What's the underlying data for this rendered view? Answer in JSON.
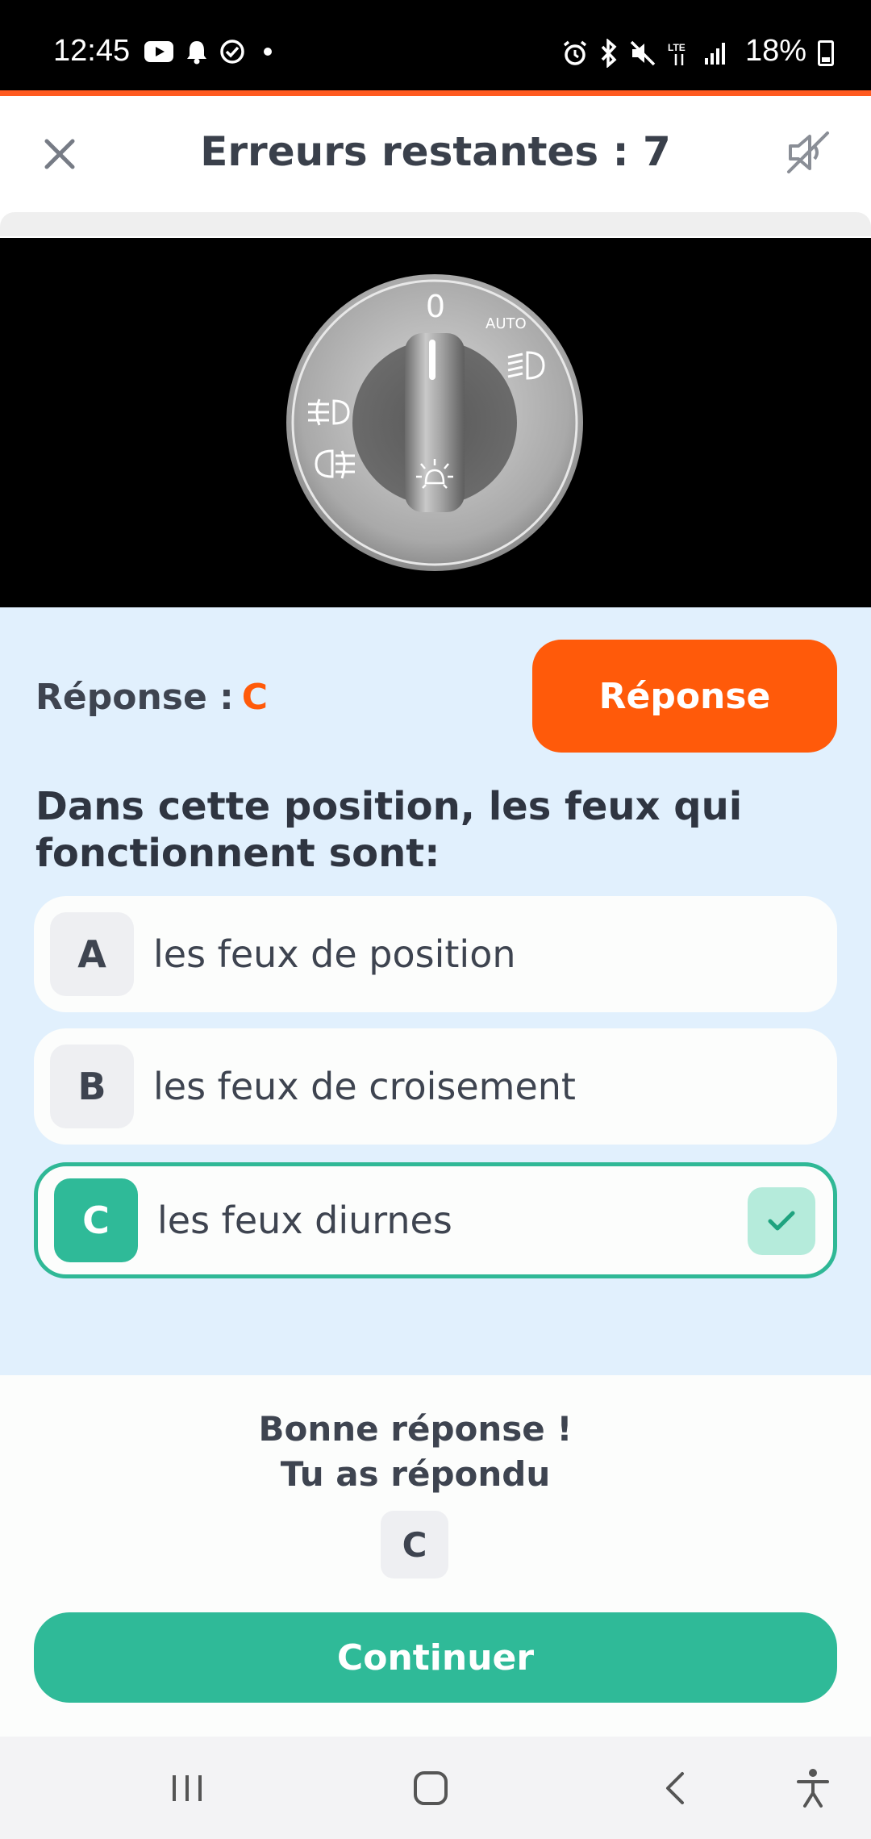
{
  "status_bar": {
    "time": "12:45",
    "battery": "18%",
    "network": "LTE",
    "icons": [
      "youtube-icon",
      "bell-icon",
      "check-circle-icon",
      "dot-icon",
      "alarm-icon",
      "bluetooth-icon",
      "mute-icon",
      "lte-icon",
      "signal-icon",
      "battery-icon"
    ]
  },
  "header": {
    "title": "Erreurs restantes : 7",
    "close_icon": "close-icon",
    "sound_icon": "sound-off-icon"
  },
  "dial": {
    "zero_label": "0",
    "auto_label": "AUTO"
  },
  "answer": {
    "label": "Réponse :",
    "letter": "C",
    "button_label": "Réponse"
  },
  "question": "Dans cette position, les feux qui fonctionnent sont:",
  "options": [
    {
      "letter": "A",
      "text": "les feux de position",
      "selected": false
    },
    {
      "letter": "B",
      "text": "les feux de croisement",
      "selected": false
    },
    {
      "letter": "C",
      "text": "les feux diurnes",
      "selected": true
    }
  ],
  "feedback": {
    "line1": "Bonne réponse !",
    "line2": "Tu as répondu",
    "answered_letter": "C",
    "continue_label": "Continuer"
  },
  "nav_bar": [
    "recents-icon",
    "home-icon",
    "back-icon",
    "accessibility-icon"
  ],
  "colors": {
    "accent": "#ff5a0a",
    "success": "#2fba98",
    "question_bg": "#e1f0fd"
  }
}
